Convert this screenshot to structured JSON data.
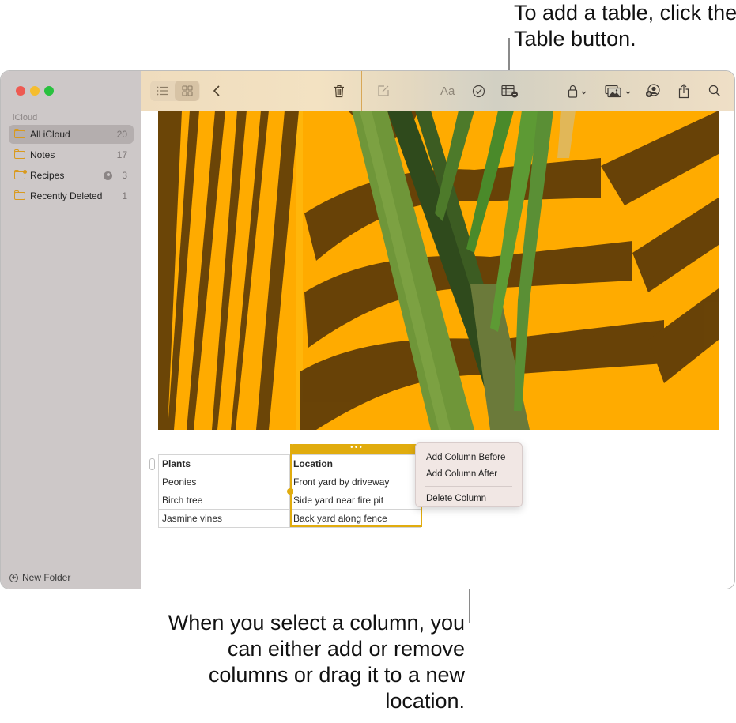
{
  "callouts": {
    "top": "To add a table, click the Table button.",
    "bottom": "When you select a column, you can either add or remove columns or drag it to a new location."
  },
  "window": {
    "sidebar": {
      "section_label": "iCloud",
      "items": [
        {
          "label": "All iCloud",
          "count": "20",
          "selected": true,
          "icon": "folder-icon"
        },
        {
          "label": "Notes",
          "count": "17",
          "selected": false,
          "icon": "folder-icon"
        },
        {
          "label": "Recipes",
          "count": "3",
          "selected": false,
          "icon": "shared-folder-icon",
          "shared": true
        },
        {
          "label": "Recently Deleted",
          "count": "1",
          "selected": false,
          "icon": "folder-icon"
        }
      ],
      "new_folder_label": "New Folder"
    },
    "toolbar": {
      "buttons": [
        "list-view-icon",
        "gallery-view-icon",
        "back-chevron-icon",
        "trash-icon",
        "compose-icon",
        "format-text-icon",
        "checklist-icon",
        "table-icon",
        "lock-icon",
        "media-icon",
        "collaborate-icon",
        "share-icon",
        "search-icon"
      ],
      "format_label": "Aa"
    },
    "note": {
      "photo_description": "Yellow wall with palm leaf shadows and green grass blades",
      "table": {
        "headers": [
          "Plants",
          "Location"
        ],
        "rows": [
          [
            "Peonies",
            "Front yard by driveway"
          ],
          [
            "Birch tree",
            "Side yard near fire pit"
          ],
          [
            "Jasmine vines",
            "Back yard along fence"
          ]
        ],
        "selected_column": "Location",
        "column_handle_glyph": "• • •"
      },
      "context_menu": {
        "items": [
          "Add Column Before",
          "Add Column After",
          "Delete Column"
        ]
      }
    }
  },
  "colors": {
    "accent_selection": "#e1ac0e",
    "folder": "#d99a1c",
    "sidebar_bg": "#cdc8c8"
  }
}
